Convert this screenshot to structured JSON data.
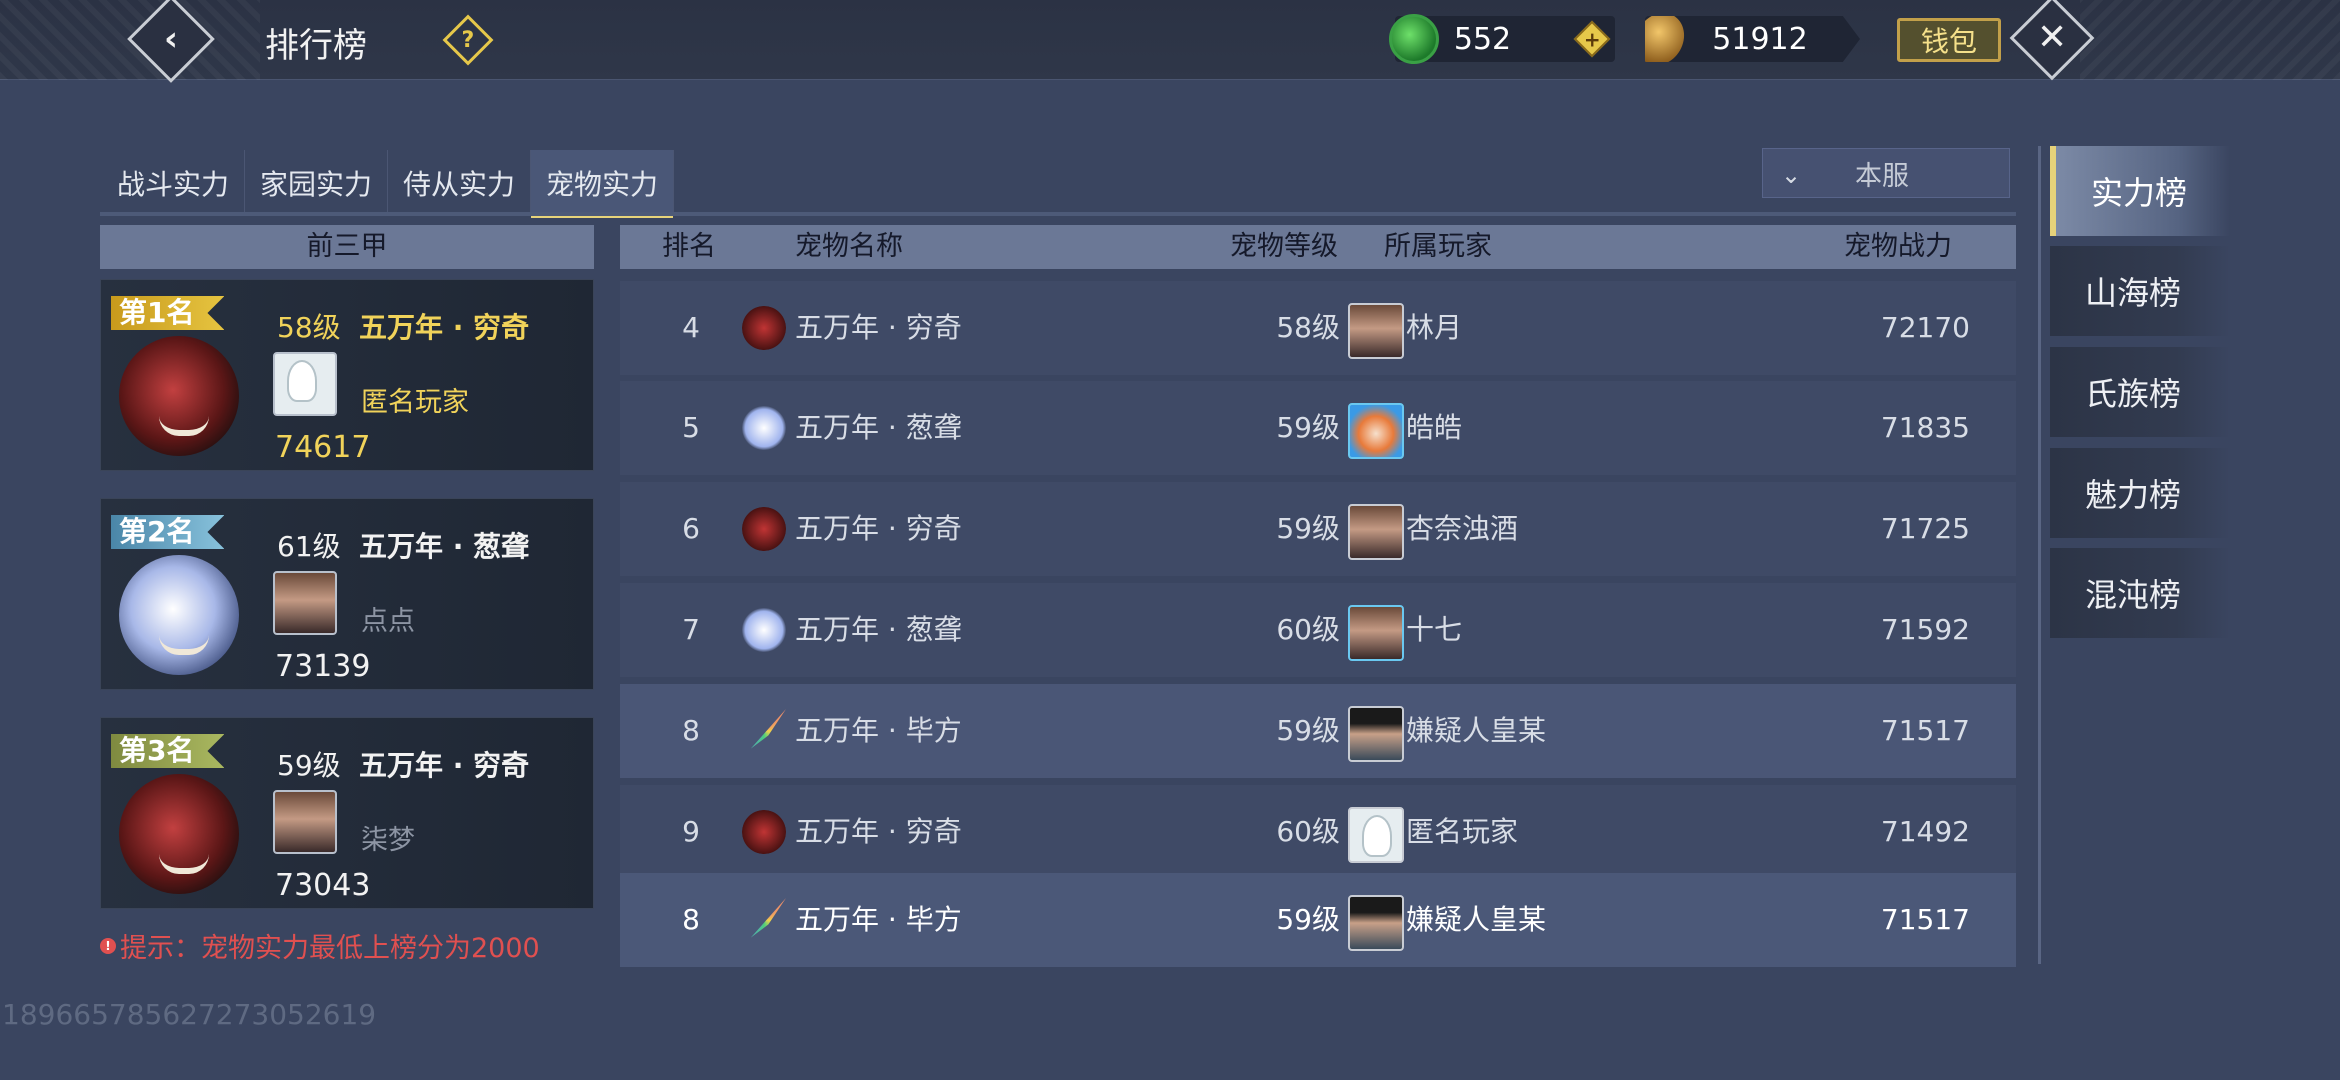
{
  "header": {
    "title": "排行榜",
    "jade_amount": "552",
    "coin_amount": "51912",
    "wallet_label": "钱包"
  },
  "tabs": [
    {
      "label": "战斗实力",
      "active": false
    },
    {
      "label": "家园实力",
      "active": false
    },
    {
      "label": "侍从实力",
      "active": false
    },
    {
      "label": "宠物实力",
      "active": true
    }
  ],
  "server_filter": {
    "value": "本服"
  },
  "top3": {
    "header": "前三甲",
    "entries": [
      {
        "badge": "第1名",
        "level": "58级",
        "pet": "五万年 · 穷奇",
        "owner": "匿名玩家",
        "power": "74617"
      },
      {
        "badge": "第2名",
        "level": "61级",
        "pet": "五万年 · 葱聋",
        "owner": "点点",
        "power": "73139"
      },
      {
        "badge": "第3名",
        "level": "59级",
        "pet": "五万年 · 穷奇",
        "owner": "柒梦",
        "power": "73043"
      }
    ]
  },
  "table": {
    "columns": {
      "rank": "排名",
      "pet": "宠物名称",
      "level": "宠物等级",
      "owner": "所属玩家",
      "power": "宠物战力"
    },
    "rows": [
      {
        "rank": "4",
        "pet": "五万年 · 穷奇",
        "level": "58级",
        "owner": "林月",
        "power": "72170"
      },
      {
        "rank": "5",
        "pet": "五万年 · 葱聋",
        "level": "59级",
        "owner": "皓皓",
        "power": "71835"
      },
      {
        "rank": "6",
        "pet": "五万年 · 穷奇",
        "level": "59级",
        "owner": "杏奈浊酒",
        "power": "71725"
      },
      {
        "rank": "7",
        "pet": "五万年 · 葱聋",
        "level": "60级",
        "owner": "十七",
        "power": "71592"
      },
      {
        "rank": "8",
        "pet": "五万年 · 毕方",
        "level": "59级",
        "owner": "嫌疑人皇某",
        "power": "71517"
      },
      {
        "rank": "9",
        "pet": "五万年 · 穷奇",
        "level": "60级",
        "owner": "匿名玩家",
        "power": "71492"
      }
    ],
    "my_row": {
      "rank": "8",
      "pet": "五万年 · 毕方",
      "level": "59级",
      "owner": "嫌疑人皇某",
      "power": "71517"
    }
  },
  "hint": "提示：宠物实力最低上榜分为2000",
  "watermark": "18966578562727305261​9",
  "side_menu": [
    {
      "label": "实力榜",
      "active": true
    },
    {
      "label": "山海榜",
      "active": false
    },
    {
      "label": "氏族榜",
      "active": false
    },
    {
      "label": "魅力榜",
      "active": false
    },
    {
      "label": "混沌榜",
      "active": false
    }
  ]
}
